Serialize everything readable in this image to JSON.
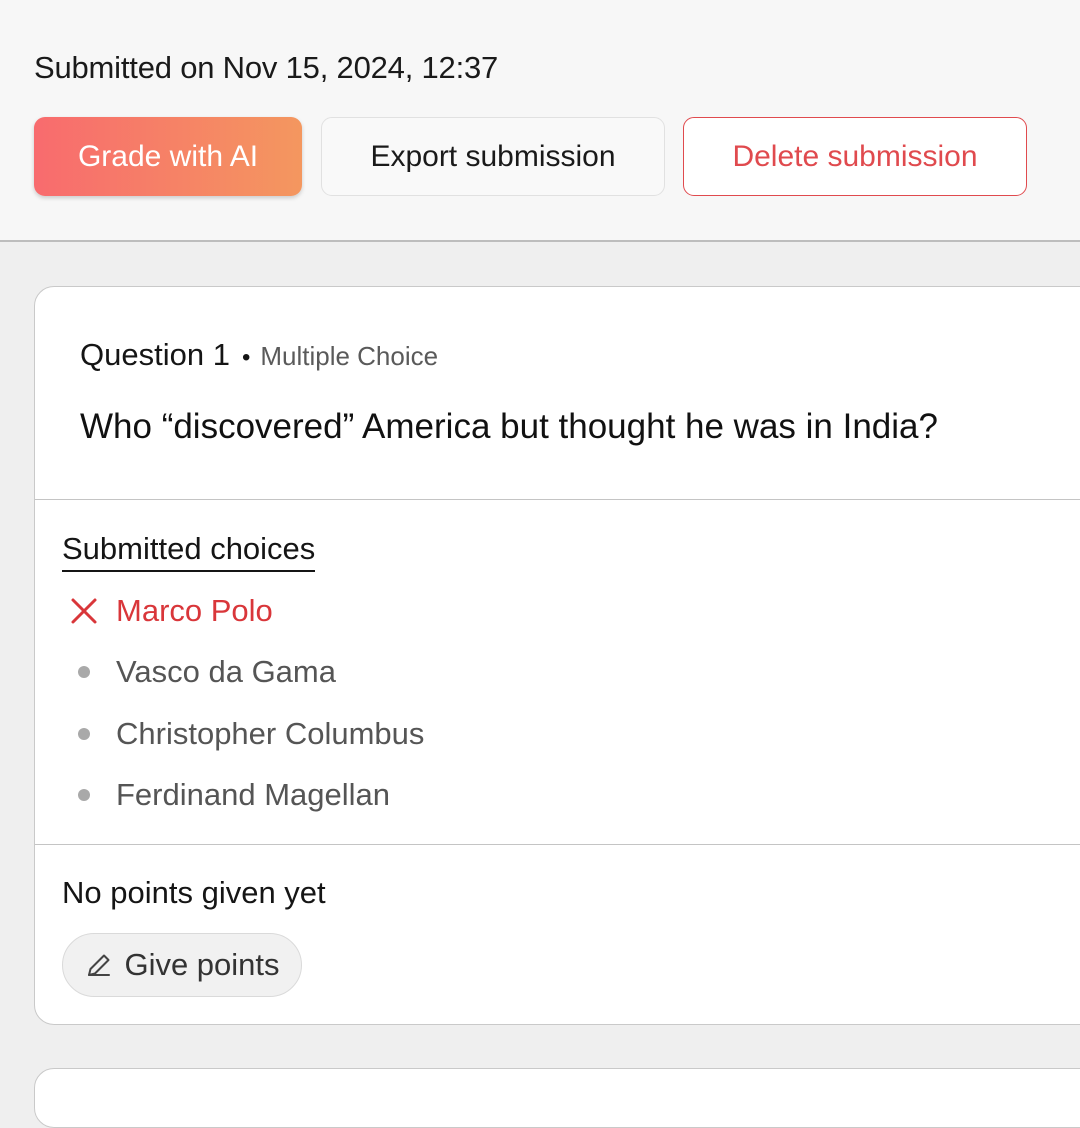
{
  "header": {
    "submitted_on": "Submitted on Nov 15, 2024, 12:37",
    "buttons": {
      "grade_ai": "Grade with AI",
      "export": "Export submission",
      "delete": "Delete submission"
    }
  },
  "question": {
    "number_label": "Question 1",
    "separator": "•",
    "type": "Multiple Choice",
    "text": "Who “discovered” America but thought he was in India?",
    "choices_title": "Submitted choices",
    "choices": [
      {
        "label": "Marco Polo",
        "status": "selected-wrong",
        "icon": "x-icon"
      },
      {
        "label": "Vasco da Gama",
        "status": "not-selected",
        "icon": "bullet-icon"
      },
      {
        "label": "Christopher Columbus",
        "status": "not-selected",
        "icon": "bullet-icon"
      },
      {
        "label": "Ferdinand Magellan",
        "status": "not-selected",
        "icon": "bullet-icon"
      }
    ],
    "points_status": "No points given yet",
    "give_points_label": "Give points"
  },
  "colors": {
    "accent_gradient_start": "#f86b6e",
    "accent_gradient_end": "#f4975f",
    "danger": "#e04a4e",
    "wrong_choice": "#d9363a"
  }
}
